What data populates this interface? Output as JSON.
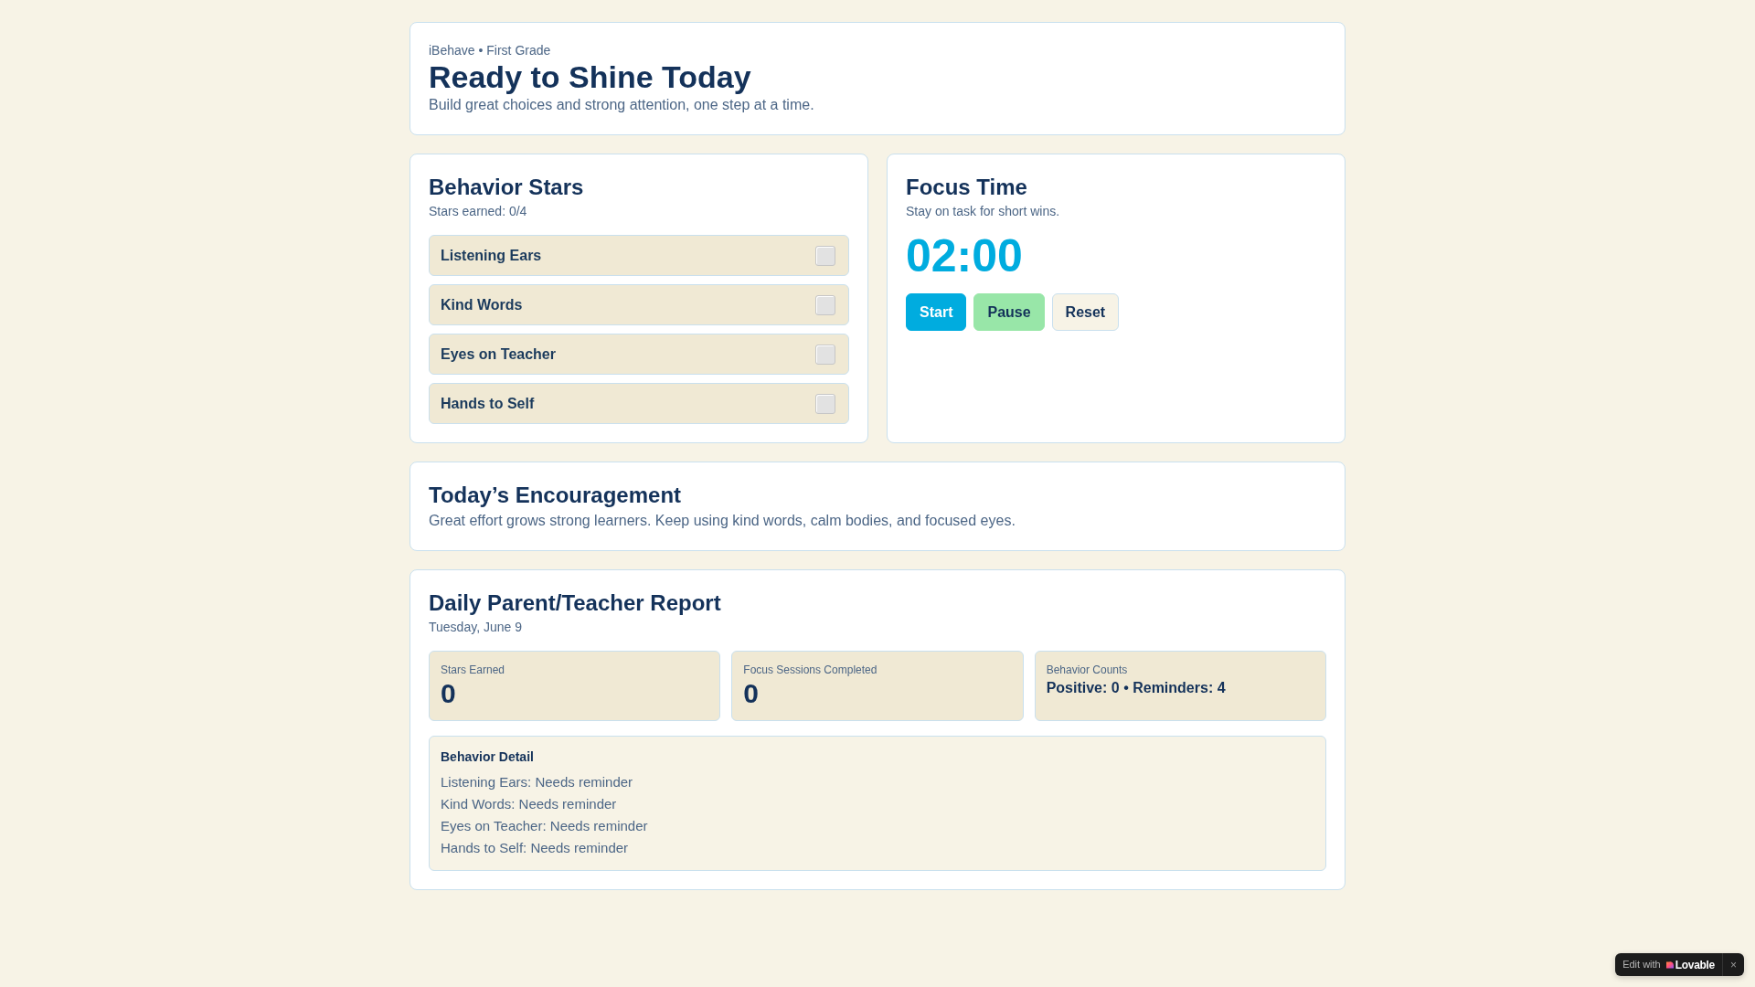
{
  "header": {
    "eyebrow": "iBehave • First Grade",
    "title": "Ready to Shine Today",
    "subtitle": "Build great choices and strong attention, one step at a time."
  },
  "behavior_stars": {
    "title": "Behavior Stars",
    "summary": "Stars earned: 0/4",
    "items": [
      {
        "label": "Listening Ears",
        "checked": false
      },
      {
        "label": "Kind Words",
        "checked": false
      },
      {
        "label": "Eyes on Teacher",
        "checked": false
      },
      {
        "label": "Hands to Self",
        "checked": false
      }
    ]
  },
  "focus_time": {
    "title": "Focus Time",
    "subtitle": "Stay on task for short wins.",
    "timer": "02:00",
    "buttons": [
      {
        "label": "Start",
        "kind": "primary"
      },
      {
        "label": "Pause",
        "kind": "success"
      },
      {
        "label": "Reset",
        "kind": "outline"
      }
    ]
  },
  "encouragement": {
    "title": "Today’s Encouragement",
    "message": "Great effort grows strong learners. Keep using kind words, calm bodies, and focused eyes."
  },
  "report": {
    "title": "Daily Parent/Teacher Report",
    "date": "Tuesday, June 9",
    "stats": [
      {
        "label": "Stars Earned",
        "value": "0",
        "kind": "big"
      },
      {
        "label": "Focus Sessions Completed",
        "value": "0",
        "kind": "big"
      },
      {
        "label": "Behavior Counts",
        "value": "Positive: 0 • Reminders: 4",
        "kind": "inline"
      }
    ],
    "detail": {
      "title": "Behavior Detail",
      "lines": [
        "Listening Ears: Needs reminder",
        "Kind Words: Needs reminder",
        "Eyes on Teacher: Needs reminder",
        "Hands to Self: Needs reminder"
      ]
    }
  },
  "badge": {
    "prefix": "Edit with",
    "brand": "Lovable",
    "close": "×"
  }
}
